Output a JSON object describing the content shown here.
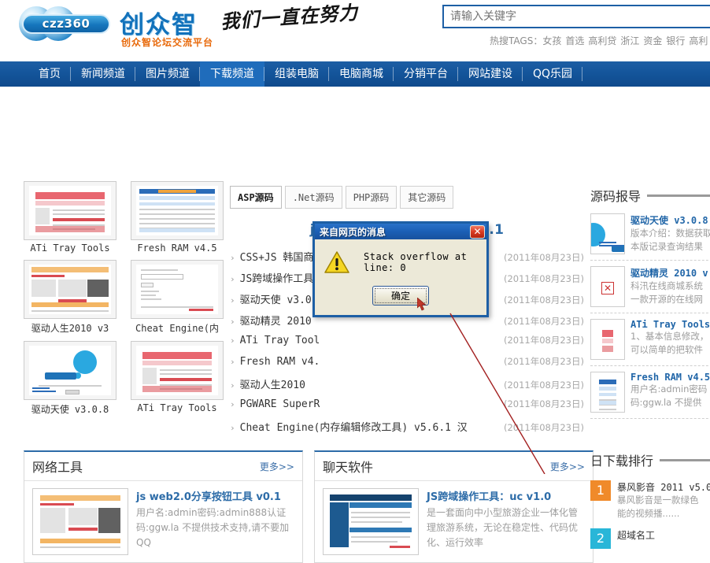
{
  "header": {
    "logo_text": "czz360",
    "logo_cn": "创众智",
    "logo_sub": "创众智论坛交流平台",
    "slogan": "我们一直在努力",
    "search_placeholder": "请输入关键字",
    "hot_tags_label": "热搜TAGS：",
    "hot_tags": [
      "女孩",
      "首选",
      "高利贷",
      "浙江",
      "资金",
      "银行",
      "高利"
    ]
  },
  "nav": {
    "items": [
      {
        "label": "首页",
        "active": false
      },
      {
        "label": "新闻频道",
        "active": false
      },
      {
        "label": "图片频道",
        "active": false
      },
      {
        "label": "下载频道",
        "active": true
      },
      {
        "label": "组装电脑",
        "active": false
      },
      {
        "label": "电脑商城",
        "active": false
      },
      {
        "label": "分销平台",
        "active": false
      },
      {
        "label": "网站建设",
        "active": false
      },
      {
        "label": "QQ乐园",
        "active": false
      }
    ]
  },
  "thumbs": [
    {
      "caption": "ATi Tray Tools",
      "style": "pink"
    },
    {
      "caption": "Fresh RAM v4.5",
      "style": "table"
    },
    {
      "caption": "驱动人生2010 v3",
      "style": "news"
    },
    {
      "caption": "Cheat Engine(内",
      "style": "form"
    },
    {
      "caption": "驱动天使 v3.0.8",
      "style": "bubble"
    },
    {
      "caption": "ATi Tray Tools",
      "style": "pink"
    }
  ],
  "center": {
    "tabs": [
      {
        "label": "ASP源码",
        "active": true
      },
      {
        "label": ".Net源码",
        "active": false
      },
      {
        "label": "PHP源码",
        "active": false
      },
      {
        "label": "其它源码",
        "active": false
      }
    ],
    "feature_title": "js web2.0分享按钮工具 v0.1",
    "list": [
      {
        "name": "CSS+JS 韩国商品购物车列表展示特效",
        "date": "(2011年08月23日)"
      },
      {
        "name": "JS跨域操作工具：uc v1.0",
        "date": "(2011年08月23日)"
      },
      {
        "name": "驱动天使 v3.0.812.1",
        "date": "(2011年08月23日)"
      },
      {
        "name": "驱动精灵 2010",
        "date": "(2011年08月23日)"
      },
      {
        "name": "ATi Tray Tool",
        "date": "(2011年08月23日)"
      },
      {
        "name": "Fresh RAM v4.",
        "date": "(2011年08月23日)"
      },
      {
        "name": "驱动人生2010",
        "date": "(2011年08月23日)"
      },
      {
        "name": "PGWARE SuperR",
        "date": "(2011年08月23日)"
      },
      {
        "name": "Cheat Engine(内存编辑修改工具) v5.6.1 汉",
        "date": "(2011年08月23日)"
      }
    ]
  },
  "sidebar": {
    "title": "源码报导",
    "items": [
      {
        "title": "驱动天使 v3.0.8",
        "desc1": "版本介绍：数据获取",
        "desc2": "本版记录查询结果",
        "style": "bubble"
      },
      {
        "title": "驱动精灵 2010 v",
        "desc1": "科汛在线商城系统",
        "desc2": "一款开源的在线网",
        "style": "broken"
      },
      {
        "title": "ATi Tray Tools",
        "desc1": "1、基本信息修改，",
        "desc2": "可以简单的把软件",
        "style": "pink"
      },
      {
        "title": "Fresh RAM v4.5",
        "desc1": "用户名:admin密码",
        "desc2": "码:ggw.la 不提供",
        "style": "table"
      }
    ]
  },
  "panels": [
    {
      "title": "网络工具",
      "more": "更多>>",
      "item_title": "js web2.0分享按钮工具 v0.1",
      "item_desc": "用户名:admin密码:admin888认证码:ggw.la 不提供技术支持,请不要加QQ",
      "thumb_style": "news"
    },
    {
      "title": "聊天软件",
      "more": "更多>>",
      "item_title": "JS跨域操作工具：uc v1.0",
      "item_desc": "是一套面向中小型旅游企业一体化管理旅游系统，无论在稳定性、代码优化、运行效率",
      "thumb_style": "admin"
    }
  ],
  "rank": {
    "title": "日下载排行",
    "items": [
      {
        "num": "1",
        "color": "#f08a2a",
        "title": "暴风影音 2011 v5.0",
        "desc1": "暴风影音是一款绿色",
        "desc2": "能的视频播......"
      },
      {
        "num": "2",
        "color": "#29b6d8",
        "title": "超域名工",
        "desc1": "",
        "desc2": ""
      }
    ]
  },
  "dialog": {
    "title": "来自网页的消息",
    "close_label": "✕",
    "message": "Stack overflow at line: 0",
    "ok_label": "确定",
    "icon": "warning-triangle"
  }
}
